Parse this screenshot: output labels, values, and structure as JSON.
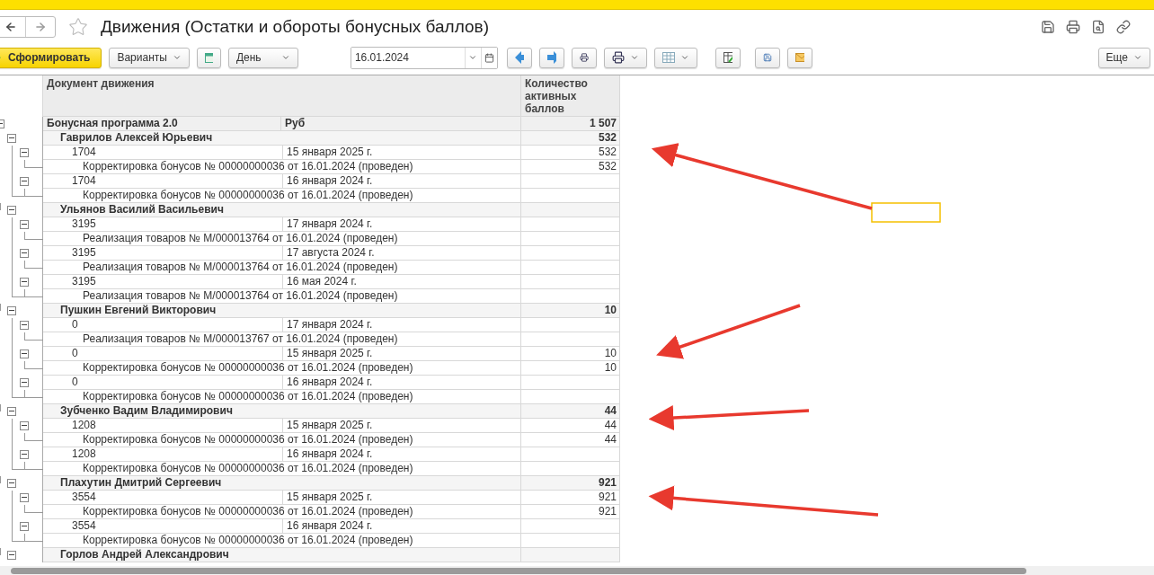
{
  "window": {
    "title": "Движения (Остатки и обороты бонусных баллов)",
    "favorite": false
  },
  "toolbar": {
    "generate_button": "Сформировать",
    "variants_button": "Варианты",
    "period": "День",
    "date": "16.01.2024",
    "more_button": "Еще"
  },
  "table": {
    "columns": [
      "Документ движения",
      "Количество активных баллов"
    ],
    "program": {
      "name": "Бонусная программа 2.0",
      "currency": "Руб",
      "total": "1 507",
      "expanded": true,
      "persons": [
        {
          "name": "Гаврилов Алексей Юрьевич",
          "total": "532",
          "expanded": true,
          "entries": [
            {
              "number": "1704",
              "date": "15 января 2025 г.",
              "value": "532",
              "expanded": true,
              "document": "Корректировка бонусов № 00000000036 от 16.01.2024 (проведен)",
              "document_value": "532"
            },
            {
              "number": "1704",
              "date": "16 января 2024 г.",
              "expanded": true,
              "document": "Корректировка бонусов № 00000000036 от 16.01.2024 (проведен)"
            }
          ]
        },
        {
          "name": "Ульянов Василий Васильевич",
          "expanded": true,
          "entries": [
            {
              "number": "3195",
              "date": "17 января 2024 г.",
              "expanded": true,
              "document": "Реализация товаров № М/000013764 от 16.01.2024 (проведен)"
            },
            {
              "number": "3195",
              "date": "17 августа 2024 г.",
              "expanded": true,
              "document": "Реализация товаров № М/000013764 от 16.01.2024 (проведен)"
            },
            {
              "number": "3195",
              "date": "16 мая 2024 г.",
              "expanded": true,
              "document": "Реализация товаров № М/000013764 от 16.01.2024 (проведен)"
            }
          ]
        },
        {
          "name": "Пушкин Евгений Викторович",
          "total": "10",
          "expanded": true,
          "entries": [
            {
              "number": "0",
              "date": "17 января 2024 г.",
              "expanded": true,
              "document": "Реализация товаров № М/000013767 от 16.01.2024 (проведен)"
            },
            {
              "number": "0",
              "date": "15 января 2025 г.",
              "value": "10",
              "expanded": true,
              "document": "Корректировка бонусов № 00000000036 от 16.01.2024 (проведен)",
              "document_value": "10"
            },
            {
              "number": "0",
              "date": "16 января 2024 г.",
              "expanded": true,
              "document": "Корректировка бонусов № 00000000036 от 16.01.2024 (проведен)"
            }
          ]
        },
        {
          "name": "Зубченко Вадим Владимирович",
          "total": "44",
          "expanded": true,
          "entries": [
            {
              "number": "1208",
              "date": "15 января 2025 г.",
              "value": "44",
              "expanded": true,
              "document": "Корректировка бонусов № 00000000036 от 16.01.2024 (проведен)",
              "document_value": "44"
            },
            {
              "number": "1208",
              "date": "16 января 2024 г.",
              "expanded": true,
              "document": "Корректировка бонусов № 00000000036 от 16.01.2024 (проведен)"
            }
          ]
        },
        {
          "name": "Плахутин Дмитрий Сергеевич",
          "total": "921",
          "expanded": true,
          "entries": [
            {
              "number": "3554",
              "date": "15 января 2025 г.",
              "value": "921",
              "expanded": true,
              "document": "Корректировка бонусов № 00000000036 от 16.01.2024 (проведен)",
              "document_value": "921"
            },
            {
              "number": "3554",
              "date": "16 января 2024 г.",
              "expanded": true,
              "document": "Корректировка бонусов № 00000000036 от 16.01.2024 (проведен)"
            }
          ]
        },
        {
          "name": "Горлов Андрей Александрович",
          "expanded": true
        }
      ]
    }
  }
}
